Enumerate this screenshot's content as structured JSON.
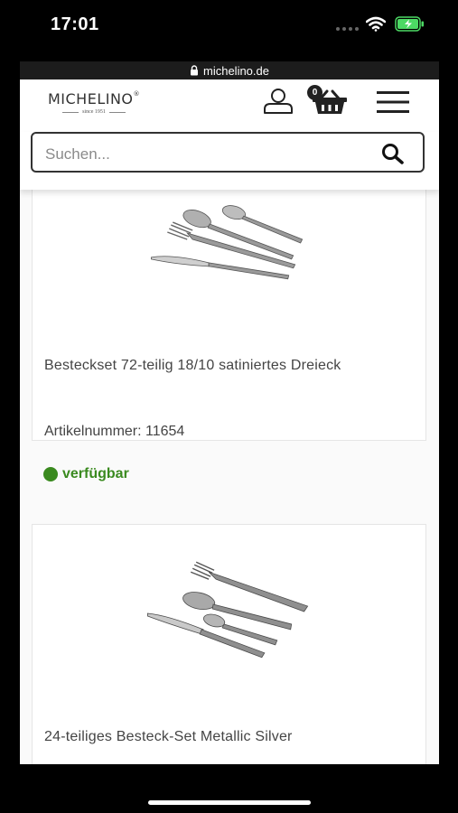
{
  "status_bar": {
    "time": "17:01"
  },
  "browser": {
    "url": "michelino.de"
  },
  "header": {
    "logo_name": "MICHELINO",
    "logo_reg": "®",
    "logo_since": "since 1951",
    "cart_count": "0"
  },
  "search": {
    "placeholder": "Suchen..."
  },
  "products": [
    {
      "title": "Besteckset 72-teilig 18/10 satiniertes Dreieck",
      "article_number": "Artikelnummer: 11654",
      "availability": "verfügbar"
    },
    {
      "title": "24-teiliges Besteck-Set Metallic Silver"
    }
  ],
  "colors": {
    "available_green": "#3a8a1f",
    "url_bar": "#1c1c1c",
    "battery_green": "#4cd964"
  }
}
